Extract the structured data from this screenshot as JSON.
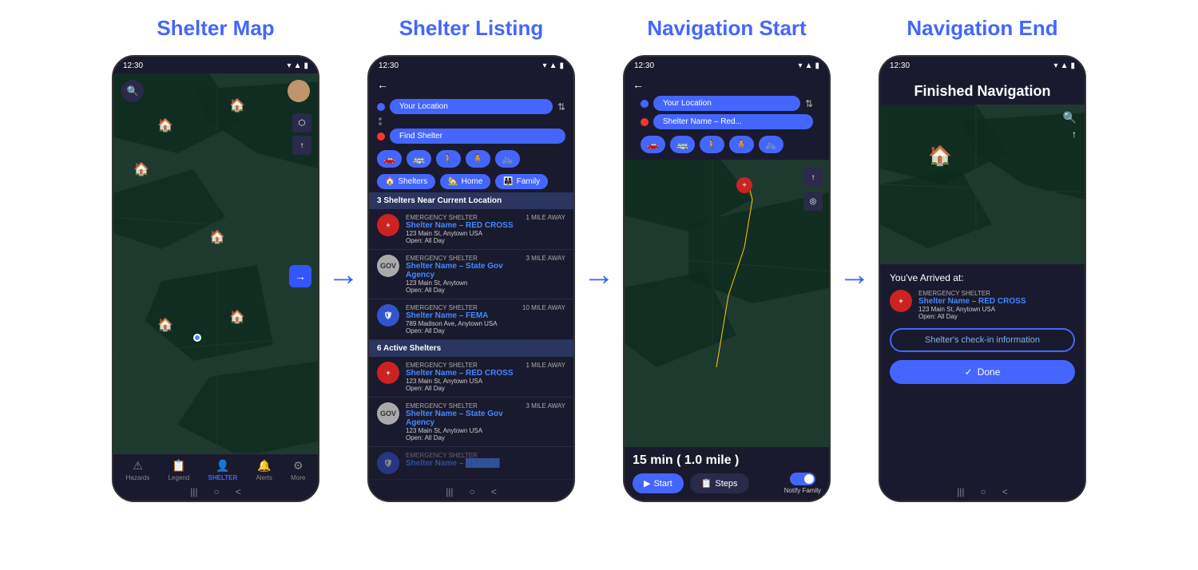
{
  "screens": [
    {
      "title": "Shelter Map",
      "statusBar": {
        "time": "12:30"
      },
      "type": "map"
    },
    {
      "title": "Shelter Listing",
      "statusBar": {
        "time": "12:30"
      },
      "type": "listing",
      "routeFrom": "Your Location",
      "routeTo": "Find Shelter",
      "transportModes": [
        "🚗",
        "🚌",
        "🚶",
        "🧍",
        "🚲"
      ],
      "filterTabs": [
        "Shelters",
        "Home",
        "Family"
      ],
      "sectionNear": "3 Shelters Near Current Location",
      "sectionActive": "6 Active Shelters",
      "shelters": [
        {
          "type": "EMERGENCY SHELTER",
          "name": "Shelter Name – RED CROSS",
          "address": "123 Main St, Anytown USA",
          "hours": "Open: All Day",
          "distance": "1 MILE AWAY",
          "logo": "red",
          "logoText": "+"
        },
        {
          "type": "EMERGENCY SHELTER",
          "name": "Shelter Name – State Gov Agency",
          "address": "123 Main St, Anytown",
          "hours": "Open: All Day",
          "distance": "3 MILE AWAY",
          "logo": "gray",
          "logoText": "GOV"
        },
        {
          "type": "EMERGENCY SHELTER",
          "name": "Shelter Name – FEMA",
          "address": "789 Madison Ave, Anytown USA",
          "hours": "Open: All Day",
          "distance": "10 MILE AWAY",
          "logo": "blue",
          "logoText": "🛡"
        },
        {
          "type": "EMERGENCY SHELTER",
          "name": "Shelter Name – RED CROSS",
          "address": "123 Main St, Anytown USA",
          "hours": "Open: All Day",
          "distance": "1 MILE AWAY",
          "logo": "red",
          "logoText": "+"
        },
        {
          "type": "EMERGENCY SHELTER",
          "name": "Shelter Name – State Gov Agency",
          "address": "123 Main St, Anytown USA",
          "hours": "Open: All Day",
          "distance": "3 MILE AWAY",
          "logo": "gray",
          "logoText": "GOV"
        }
      ]
    },
    {
      "title": "Navigation Start",
      "statusBar": {
        "time": "12:30"
      },
      "type": "navigation",
      "routeFrom": "Your Location",
      "routeTo": "Shelter Name – Red...",
      "routeTime": "15 min ( 1.0 mile )",
      "startLabel": "Start",
      "stepsLabel": "Steps",
      "notifyLabel": "Notify Family"
    },
    {
      "title": "Navigation End",
      "statusBar": {
        "time": "12:30"
      },
      "type": "nav-end",
      "finishedTitle": "Finished Navigation",
      "arrivedText": "You've Arrived at:",
      "shelterType": "EMERGENCY SHELTER",
      "shelterName": "Shelter Name – RED CROSS",
      "shelterAddress": "123 Main St, Anytown USA",
      "shelterHours": "Open: All Day",
      "checkinLabel": "Shelter's check-in information",
      "doneLabel": "Done"
    }
  ],
  "arrows": [
    "→",
    "→",
    "→"
  ]
}
